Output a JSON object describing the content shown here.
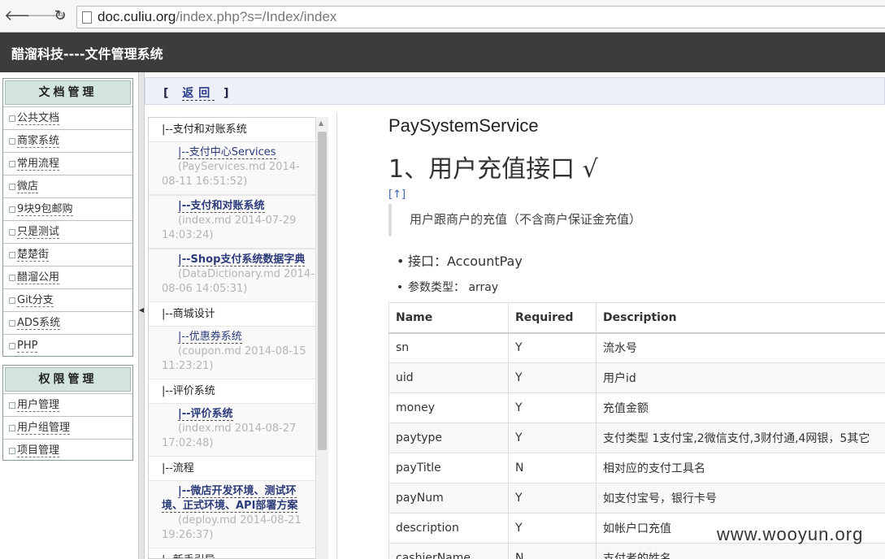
{
  "browser": {
    "back_glyph": "🡐",
    "forward_glyph": "🡒",
    "reload_glyph": "↻",
    "url_host": "doc.culiu.org",
    "url_rest": "/index.php?s=/Index/index"
  },
  "app": {
    "title": "醋溜科技----文件管理系统"
  },
  "sidebar": {
    "docs_title": "文档管理",
    "docs_items": [
      {
        "label": "公共文档"
      },
      {
        "label": "商家系统"
      },
      {
        "label": "常用流程"
      },
      {
        "label": "微店"
      },
      {
        "label": "9块9包邮购"
      },
      {
        "label": "只是测试"
      },
      {
        "label": "楚楚街"
      },
      {
        "label": "醋溜公用"
      },
      {
        "label": "Git分支"
      },
      {
        "label": "ADS系统"
      },
      {
        "label": "PHP"
      }
    ],
    "perm_title": "权限管理",
    "perm_items": [
      {
        "label": "用户管理"
      },
      {
        "label": "用户组管理"
      },
      {
        "label": "项目管理"
      }
    ]
  },
  "toolbar": {
    "open_bracket": "[",
    "back_label": "返回",
    "close_bracket": "]"
  },
  "filelist": {
    "g1": "|--支付和对账系统",
    "d1": {
      "title": "|--支付中心Services",
      "meta1": "(PayServices.md  2014-",
      "meta2": "08-11 16:51:52)"
    },
    "d2": {
      "title": "|--支付和对账系统",
      "meta1": "(index.md  2014-07-29",
      "meta2": "14:03:24)"
    },
    "d3": {
      "title": "|--Shop支付系统数据字典",
      "meta1": "(DataDictionary.md  2014-",
      "meta2": "08-06 14:05:31)"
    },
    "g2": "|--商城设计",
    "d4": {
      "title": "|--优惠券系统",
      "meta1": "(coupon.md  2014-08-15",
      "meta2": "11:23:21)"
    },
    "g3": "|--评价系统",
    "d5": {
      "title": "|--评价系统",
      "meta1": "(index.md  2014-08-27",
      "meta2": "17:02:48)"
    },
    "g4": "|--流程",
    "d6": {
      "title": "|--微店开发环境、测试环境、正式环境、API部署方案",
      "meta1": "(deploy.md  2014-08-21",
      "meta2": "19:26:37)"
    },
    "g5": "|--新手引导"
  },
  "content": {
    "title": "PaySystemService",
    "h1": "1、用户充值接口 √",
    "top_link": "[↑]",
    "quote": "用户跟商户的充值（不含商户保证金充值）",
    "api_line": "接口：AccountPay",
    "param_type_line": "参数类型： array",
    "table": {
      "headers": [
        "Name",
        "Required",
        "Description"
      ],
      "rows": [
        [
          "sn",
          "Y",
          "流水号"
        ],
        [
          "uid",
          "Y",
          "用户id"
        ],
        [
          "money",
          "Y",
          "充值金额"
        ],
        [
          "paytype",
          "Y",
          "支付类型 1支付宝,2微信支付,3财付通,4网银，5其它"
        ],
        [
          "payTitle",
          "N",
          "相对应的支付工具名"
        ],
        [
          "payNum",
          "Y",
          "如支付宝号，银行卡号"
        ],
        [
          "description",
          "Y",
          "如帐户口充值"
        ],
        [
          "cashierName",
          "N",
          "支付者的姓名"
        ]
      ]
    }
  },
  "watermark": "www.wooyun.org"
}
